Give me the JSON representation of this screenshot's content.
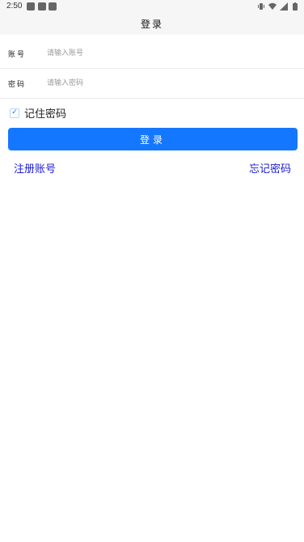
{
  "status_bar": {
    "time": "2:50",
    "notification_icons": [
      "app-icon",
      "app-icon",
      "app-icon"
    ],
    "right_icons": [
      "vibrate-icon",
      "wifi-icon",
      "signal-icon",
      "battery-icon"
    ]
  },
  "header": {
    "title": "登录"
  },
  "form": {
    "account": {
      "label": "账号",
      "placeholder": "请输入账号",
      "value": ""
    },
    "password": {
      "label": "密码",
      "placeholder": "请输入密码",
      "value": ""
    }
  },
  "remember": {
    "checked": true,
    "label": "记住密码"
  },
  "actions": {
    "login_label": "登录",
    "register_label": "注册账号",
    "forgot_label": "忘记密码"
  },
  "colors": {
    "primary": "#1477ff",
    "link": "#1b1bd6",
    "header_bg": "#f6f6f6"
  }
}
